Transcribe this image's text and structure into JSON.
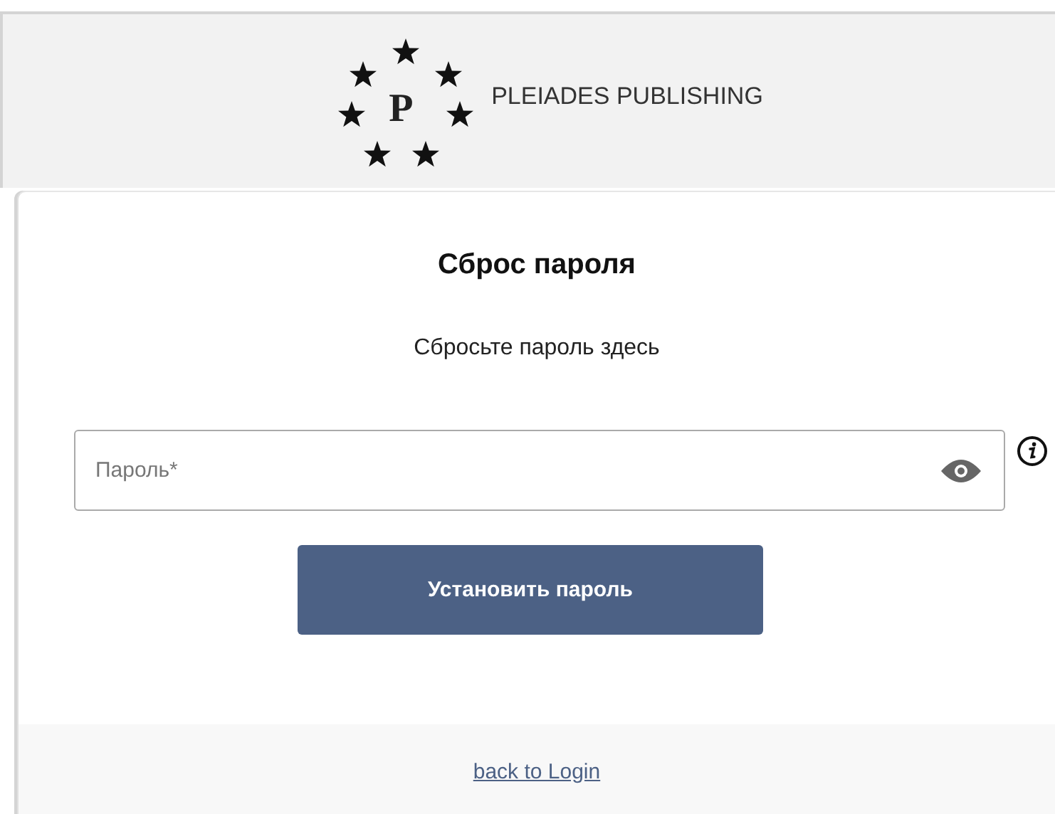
{
  "logo": {
    "letter": "P",
    "name": "PLEIADES PUBLISHING"
  },
  "card": {
    "title": "Сброс пароля",
    "subtitle": "Сбросьте пароль здесь"
  },
  "password_field": {
    "placeholder": "Пароль*"
  },
  "submit_button": {
    "label": "Установить пароль"
  },
  "footer": {
    "link": "back to Login"
  }
}
